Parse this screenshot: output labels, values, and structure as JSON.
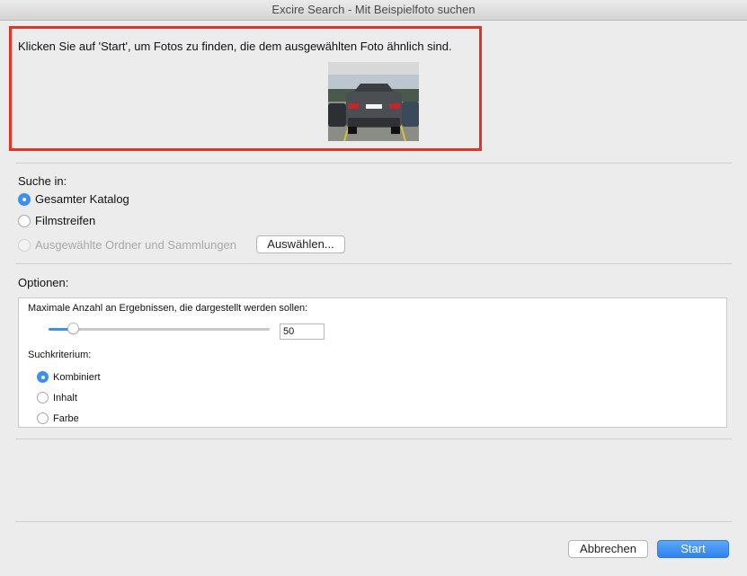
{
  "window": {
    "title": "Excire Search - Mit Beispielfoto suchen"
  },
  "hint": {
    "text": "Klicken Sie auf 'Start', um Fotos zu finden, die dem ausgewählten Foto ähnlich sind."
  },
  "search_in": {
    "label": "Suche in:",
    "options": [
      {
        "label": "Gesamter Katalog",
        "selected": true,
        "enabled": true
      },
      {
        "label": "Filmstreifen",
        "selected": false,
        "enabled": true
      },
      {
        "label": "Ausgewählte Ordner und Sammlungen",
        "selected": false,
        "enabled": false
      }
    ],
    "select_button": "Auswählen..."
  },
  "options": {
    "label": "Optionen:",
    "max_results_label": "Maximale Anzahl an Ergebnissen, die dargestellt werden sollen:",
    "max_results_value": "50",
    "slider_fraction": 0.11,
    "criterion_label": "Suchkriterium:",
    "criteria": [
      {
        "label": "Kombiniert",
        "selected": true
      },
      {
        "label": "Inhalt",
        "selected": false
      },
      {
        "label": "Farbe",
        "selected": false
      }
    ]
  },
  "footer": {
    "cancel": "Abbrechen",
    "start": "Start"
  },
  "colors": {
    "accent": "#3b8ff5",
    "highlight_border": "#e53222"
  }
}
